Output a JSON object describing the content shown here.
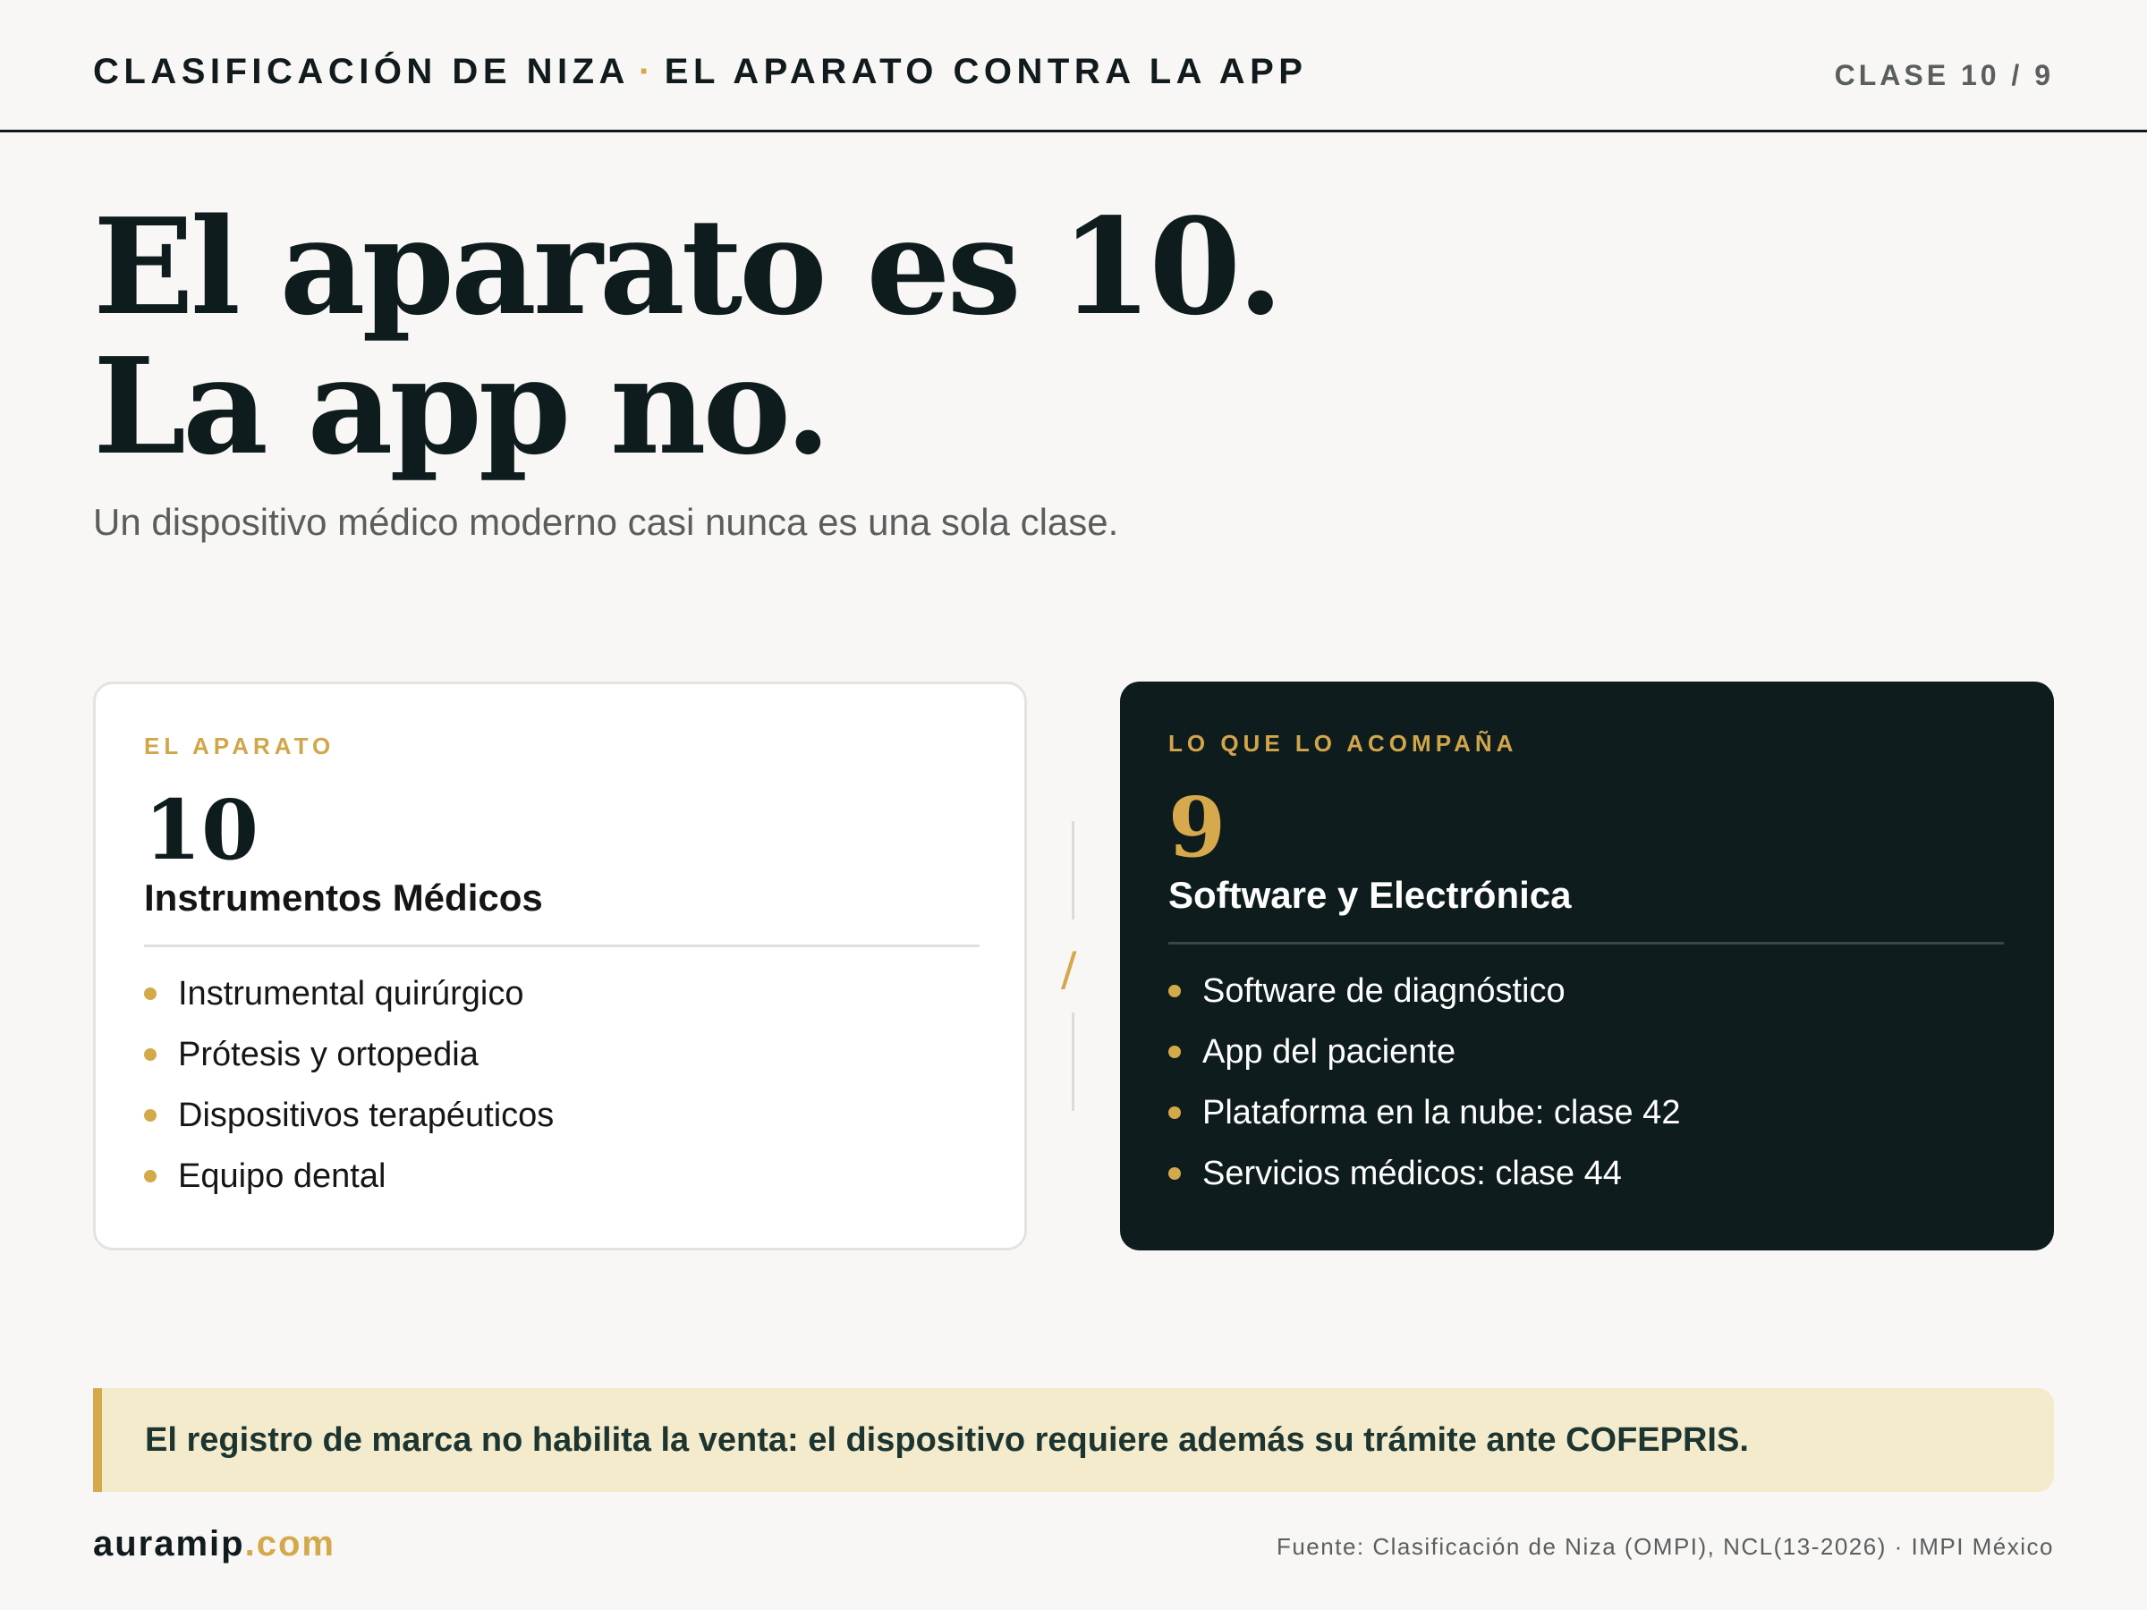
{
  "header": {
    "title_main": "CLASIFICACIÓN DE NIZA",
    "separator": "·",
    "title_sub": "EL APARATO CONTRA LA APP",
    "class_indicator": "CLASE 10 / 9"
  },
  "hero": {
    "line1": "El aparato es 10.",
    "line2": "La app no.",
    "subtitle": "Un dispositivo médico moderno casi nunca es una sola clase."
  },
  "cards": {
    "left": {
      "kicker": "EL APARATO",
      "number": "10",
      "heading": "Instrumentos Médicos",
      "items": [
        "Instrumental quirúrgico",
        "Prótesis y ortopedia",
        "Dispositivos terapéuticos",
        "Equipo dental"
      ]
    },
    "right": {
      "kicker": "LO QUE LO ACOMPAÑA",
      "number": "9",
      "heading": "Software y Electrónica",
      "items": [
        "Software de diagnóstico",
        "App del paciente",
        "Plataforma en la nube: clase 42",
        "Servicios médicos: clase 44"
      ]
    }
  },
  "divider": {
    "glyph": "/"
  },
  "note": {
    "text": "El registro de marca no habilita la venta: el dispositivo requiere además su trámite ante COFEPRIS."
  },
  "footer": {
    "brand_name": "auramip",
    "brand_tld": ".com",
    "source": "Fuente: Clasificación de Niza (OMPI), NCL(13-2026) · IMPI México"
  },
  "colors": {
    "accent": "#d4a94a",
    "dark": "#0f1c1e",
    "background": "#f8f7f5",
    "note_bg": "#f4ebcd"
  }
}
